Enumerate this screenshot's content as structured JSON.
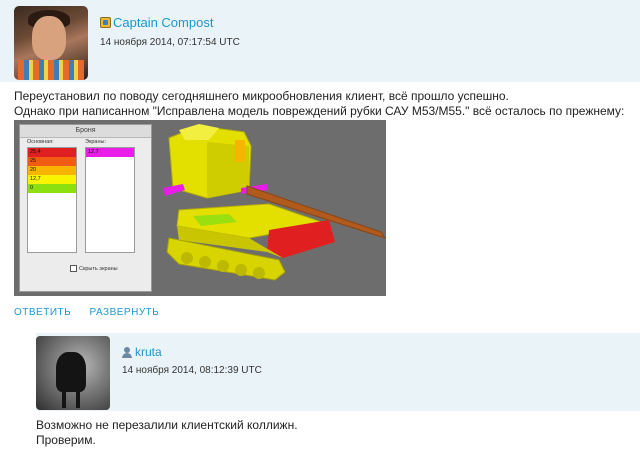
{
  "post": {
    "author": "Captain Compost",
    "timestamp": "14 ноября 2014, 07:17:54 UTC",
    "body_line1": "Переустановил по поводу сегодняшнего микрообновления клиент, всё прошло успешно.",
    "body_line2": "Однако при написанном \"Исправлена модель повреждений рубки САУ M53/M55.\" всё осталось по прежнему:",
    "actions": {
      "reply": "ОТВЕТИТЬ",
      "expand": "РАЗВЕРНУТЬ"
    }
  },
  "screenshot": {
    "window_title": "Броня",
    "main_label": "Основная:",
    "screens_label": "Экраны:",
    "main_values": [
      {
        "value": "25,4",
        "color": "#e02020"
      },
      {
        "value": "25",
        "color": "#f25b12"
      },
      {
        "value": "20",
        "color": "#f9b400"
      },
      {
        "value": "12,7",
        "color": "#f8f400"
      },
      {
        "value": "0",
        "color": "#8ce010"
      }
    ],
    "screen_values": [
      {
        "value": "12,7",
        "color": "#e81ee8"
      }
    ],
    "hide_screens_label": "Скрыть экраны"
  },
  "reply": {
    "author": "kruta",
    "timestamp": "14 ноября 2014, 08:12:39 UTC",
    "body_line1": "Возможно не перезалили клиентский коллижн.",
    "body_line2": "Проверим."
  }
}
